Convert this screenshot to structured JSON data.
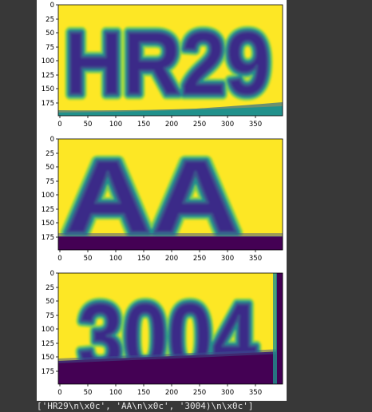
{
  "output": {
    "result_text": "['HR29\\n\\x0c', 'AA\\n\\x0c', '3004)\\n\\x0c']"
  },
  "colors": {
    "page_background": "#383838",
    "figure_background": "#ffffff",
    "viridis_yellow": "#fde725",
    "viridis_green": "#7fd34e",
    "viridis_teal": "#21918c",
    "viridis_blue": "#3b528b",
    "viridis_purple": "#440154"
  },
  "chart_data": [
    {
      "type": "heatmap",
      "image_text": "HR29",
      "xticks": [
        "0",
        "50",
        "100",
        "150",
        "200",
        "250",
        "300",
        "350"
      ],
      "yticks": [
        "0",
        "25",
        "50",
        "75",
        "100",
        "125",
        "150",
        "175"
      ],
      "xlim": [
        0,
        400
      ],
      "ylim": [
        198,
        0
      ]
    },
    {
      "type": "heatmap",
      "image_text": "AA",
      "xticks": [
        "0",
        "50",
        "100",
        "150",
        "200",
        "250",
        "300",
        "350"
      ],
      "yticks": [
        "0",
        "25",
        "50",
        "75",
        "100",
        "125",
        "150",
        "175"
      ],
      "xlim": [
        0,
        400
      ],
      "ylim": [
        198,
        0
      ]
    },
    {
      "type": "heatmap",
      "image_text": "3004",
      "xticks": [
        "0",
        "50",
        "100",
        "150",
        "200",
        "250",
        "300",
        "350"
      ],
      "yticks": [
        "0",
        "25",
        "50",
        "75",
        "100",
        "125",
        "150",
        "175"
      ],
      "xlim": [
        0,
        400
      ],
      "ylim": [
        198,
        0
      ]
    }
  ]
}
